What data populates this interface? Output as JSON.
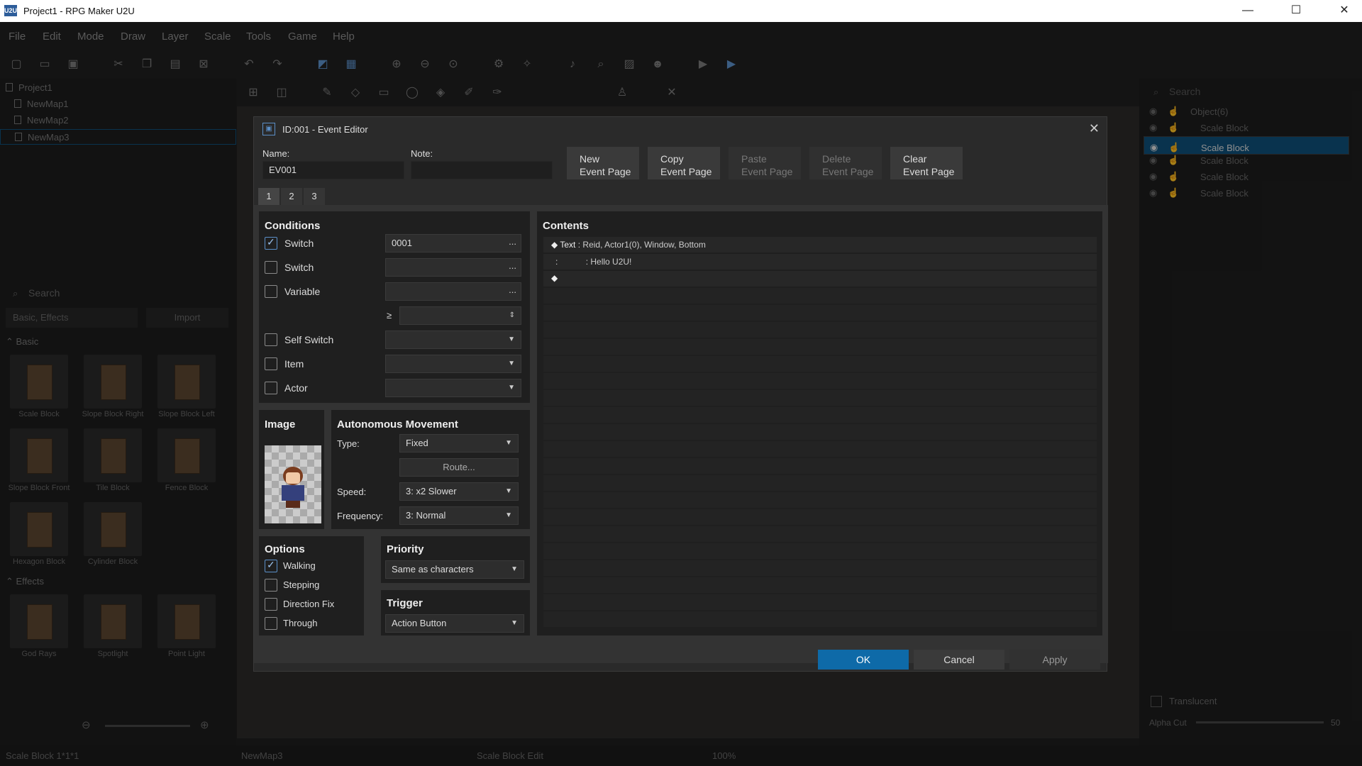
{
  "window": {
    "icon": "U2U",
    "title": "Project1 - RPG Maker U2U",
    "controls": {
      "minimize": "—",
      "maximize": "☐",
      "close": "✕"
    }
  },
  "menu": [
    "File",
    "Edit",
    "Mode",
    "Draw",
    "Layer",
    "Scale",
    "Tools",
    "Game",
    "Help"
  ],
  "project_tree": {
    "root": "Project1",
    "maps": [
      "NewMap1",
      "NewMap2",
      "NewMap3"
    ]
  },
  "assets": {
    "search_placeholder": "Search",
    "filter": "Basic, Effects",
    "import_label": "Import",
    "basic_section": "Basic",
    "basic_items": [
      "Scale Block",
      "Slope Block Right",
      "Slope Block Left",
      "Slope Block Front",
      "Tile Block",
      "Fence Block",
      "Hexagon Block",
      "Cylinder Block"
    ],
    "effects_section": "Effects",
    "effects_items": [
      "God Rays",
      "Spotlight",
      "Point Light"
    ]
  },
  "objects_panel": {
    "search_placeholder": "Search",
    "group": "Object(6)",
    "items": [
      "Scale Block",
      "Scale Block",
      "Scale Block",
      "Scale Block",
      "Scale Block"
    ],
    "translucent_label": "Translucent",
    "alpha_cut_label": "Alpha Cut",
    "alpha_cut_value": "50"
  },
  "status": {
    "left": "Scale Block 1*1*1",
    "map": "NewMap3",
    "mode": "Scale Block Edit",
    "zoom": "100%"
  },
  "dialog": {
    "title": "ID:001 - Event Editor",
    "name_label": "Name:",
    "name_value": "EV001",
    "note_label": "Note:",
    "note_value": "",
    "page_buttons": [
      {
        "line1": "New",
        "line2": "Event Page"
      },
      {
        "line1": "Copy",
        "line2": "Event Page"
      },
      {
        "line1": "Paste",
        "line2": "Event Page"
      },
      {
        "line1": "Delete",
        "line2": "Event Page"
      },
      {
        "line1": "Clear",
        "line2": "Event Page"
      }
    ],
    "tabs": [
      "1",
      "2",
      "3"
    ],
    "conditions": {
      "title": "Conditions",
      "switch1_label": "Switch",
      "switch1_value": "0001",
      "switch2_label": "Switch",
      "variable_label": "Variable",
      "gte_symbol": "≥",
      "self_switch_label": "Self Switch",
      "item_label": "Item",
      "actor_label": "Actor",
      "ellipsis": "..."
    },
    "image_title": "Image",
    "movement": {
      "title": "Autonomous Movement",
      "type_label": "Type:",
      "type_value": "Fixed",
      "route_label": "Route...",
      "speed_label": "Speed:",
      "speed_value": "3: x2 Slower",
      "frequency_label": "Frequency:",
      "frequency_value": "3: Normal"
    },
    "options": {
      "title": "Options",
      "walking": "Walking",
      "stepping": "Stepping",
      "direction_fix": "Direction Fix",
      "through": "Through"
    },
    "priority": {
      "title": "Priority",
      "value": "Same as characters"
    },
    "trigger": {
      "title": "Trigger",
      "value": "Action Button"
    },
    "contents": {
      "title": "Contents",
      "line1_cmd": "Text",
      "line1_sep": ":",
      "line1_args": "Reid, Actor1(0), Window, Bottom",
      "line2_prefix": ":",
      "line2_sep": ":",
      "line2_text": "Hello U2U!"
    },
    "ok_label": "OK",
    "cancel_label": "Cancel",
    "apply_label": "Apply"
  },
  "colors": {
    "accent": "#0e6aa8",
    "selection": "#0e4f78"
  }
}
